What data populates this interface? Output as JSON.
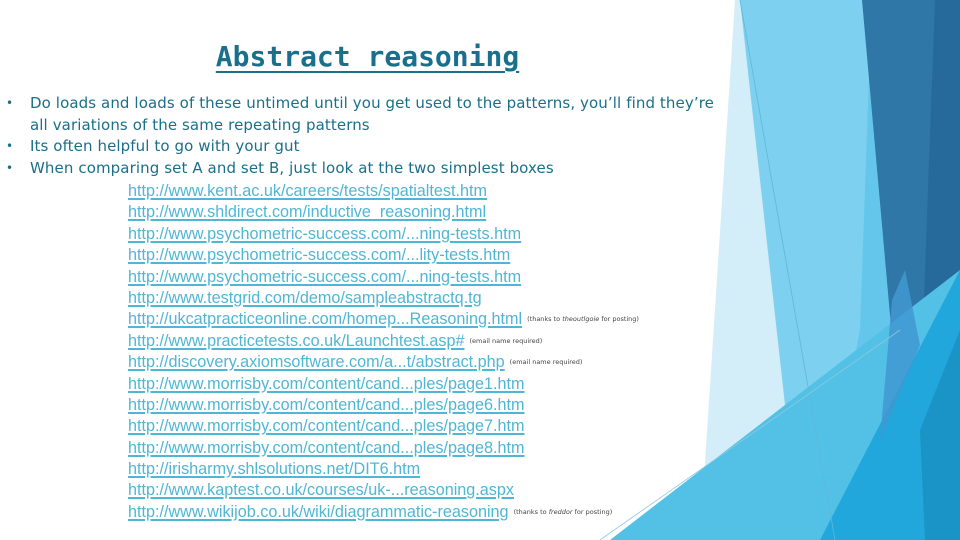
{
  "slide": {
    "title": "Abstract reasoning",
    "bullets": [
      "Do loads and loads of these untimed until you get used to the patterns, you’ll find they’re all variations of the same repeating patterns",
      "Its often helpful to go with your gut",
      "When comparing set A and set B, just look at the two simplest boxes"
    ],
    "bullet_symbol": "•",
    "links": [
      {
        "text": "http://www.kent.ac.uk/careers/tests/spatialtest.htm"
      },
      {
        "text": "http://www.shldirect.com/inductive_reasoning.html"
      },
      {
        "text": "http://www.psychometric-success.com/...ning-tests.htm"
      },
      {
        "text": "http://www.psychometric-success.com/...lity-tests.htm"
      },
      {
        "text": "http://www.psychometric-success.com/...ning-tests.htm"
      },
      {
        "text": "http://www.testgrid.com/demo/sampleabstractq.tg"
      },
      {
        "text": "http://ukcatpracticeonline.com/homep...Reasoning.html",
        "note_pre": "(thanks to ",
        "note_name": "theoutlgoie",
        "note_post": " for posting)"
      },
      {
        "text": "http://www.practicetests.co.uk/Launchtest.asp#",
        "note": "(email name required)"
      },
      {
        "text": "http://discovery.axiomsoftware.com/a...t/abstract.php",
        "note": "(email name required)"
      },
      {
        "text": "http://www.morrisby.com/content/cand...ples/page1.htm"
      },
      {
        "text": "http://www.morrisby.com/content/cand...ples/page6.htm"
      },
      {
        "text": "http://www.morrisby.com/content/cand...ples/page7.htm"
      },
      {
        "text": "http://www.morrisby.com/content/cand...ples/page8.htm"
      },
      {
        "text": "http://irisharmy.shlsolutions.net/DIT6.htm"
      },
      {
        "text": "http://www.kaptest.co.uk/courses/uk-...reasoning.aspx"
      },
      {
        "text": "http://www.wikijob.co.uk/wiki/diagrammatic-reasoning",
        "note_pre": "(thanks to ",
        "note_name": "freddor",
        "note_post": " for posting)"
      }
    ]
  },
  "theme": {
    "title_color": "#1a6f8c",
    "body_color": "#1b6f88",
    "link_color": "#4fb6d6"
  }
}
